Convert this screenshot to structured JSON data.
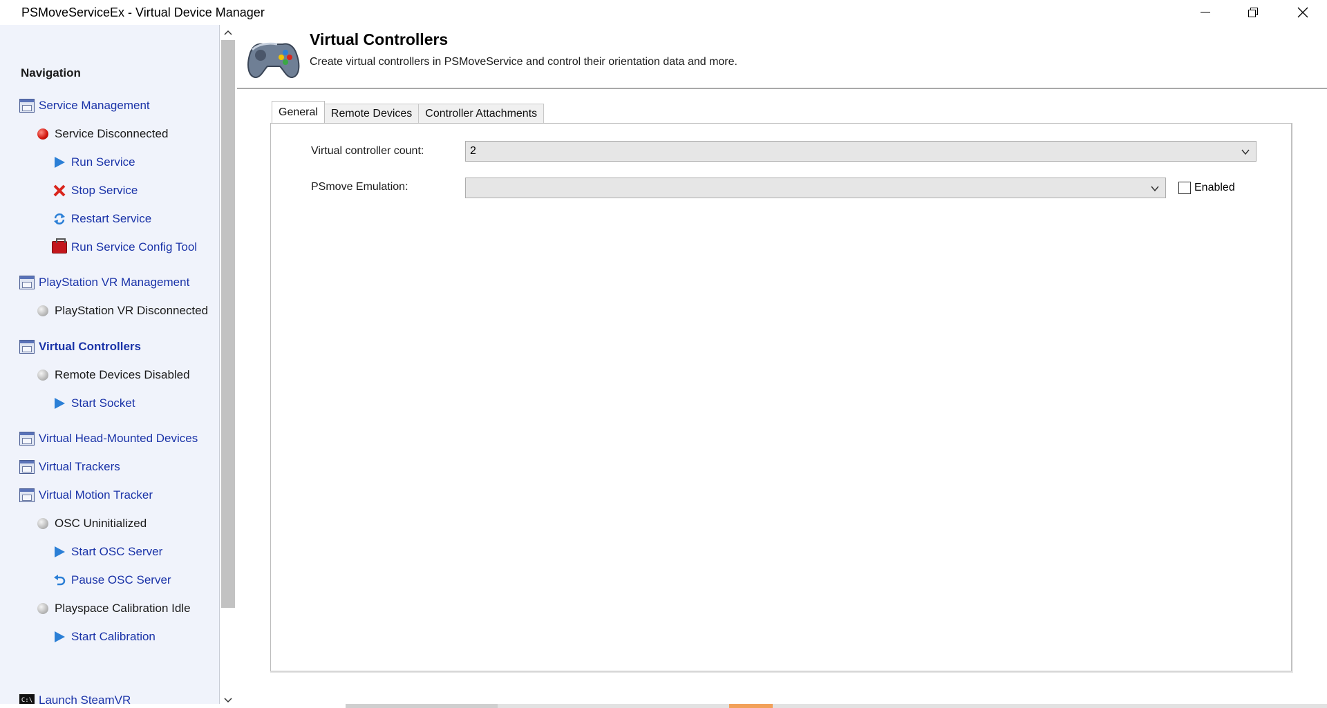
{
  "window": {
    "title": "PSMoveServiceEx - Virtual Device Manager",
    "minimize_icon": "minimize-icon",
    "maximize_icon": "restore-icon",
    "close_icon": "close-icon"
  },
  "sidebar": {
    "heading": "Navigation",
    "items": [
      {
        "label": "Service Management",
        "icon": "pc-icon"
      },
      {
        "label": "Service Disconnected",
        "icon": "red-status-dot"
      },
      {
        "label": "Run Service",
        "icon": "play-icon"
      },
      {
        "label": "Stop Service",
        "icon": "stop-x-icon"
      },
      {
        "label": "Restart Service",
        "icon": "refresh-icon"
      },
      {
        "label": "Run Service Config Tool",
        "icon": "toolbox-icon"
      },
      {
        "label": "PlayStation VR Management",
        "icon": "pc-icon"
      },
      {
        "label": "PlayStation VR Disconnected",
        "icon": "grey-status-dot"
      },
      {
        "label": "Virtual Controllers",
        "icon": "pc-icon"
      },
      {
        "label": "Remote Devices Disabled",
        "icon": "grey-status-dot"
      },
      {
        "label": "Start Socket",
        "icon": "play-icon"
      },
      {
        "label": "Virtual Head-Mounted Devices",
        "icon": "pc-icon"
      },
      {
        "label": "Virtual Trackers",
        "icon": "pc-icon"
      },
      {
        "label": "Virtual Motion Tracker",
        "icon": "pc-icon"
      },
      {
        "label": "OSC Uninitialized",
        "icon": "grey-status-dot"
      },
      {
        "label": "Start OSC Server",
        "icon": "play-icon"
      },
      {
        "label": "Pause OSC Server",
        "icon": "undo-icon"
      },
      {
        "label": "Playspace Calibration Idle",
        "icon": "grey-status-dot"
      },
      {
        "label": "Start Calibration",
        "icon": "play-icon"
      },
      {
        "label": "Launch SteamVR",
        "icon": "console-icon"
      }
    ]
  },
  "header": {
    "title": "Virtual Controllers",
    "subtitle": "Create virtual controllers in PSMoveService and control their orientation data and more.",
    "icon": "gamepad-icon"
  },
  "tabs": [
    {
      "label": "General",
      "active": true
    },
    {
      "label": "Remote Devices",
      "active": false
    },
    {
      "label": "Controller Attachments",
      "active": false
    }
  ],
  "general": {
    "controller_count_label": "Virtual controller count:",
    "controller_count_value": "2",
    "psmove_emulation_label": "PSmove Emulation:",
    "psmove_emulation_value": "",
    "enabled_label": "Enabled",
    "enabled_checked": false
  },
  "colors": {
    "link": "#1a33a8",
    "sidebar_bg": "#f0f3fb",
    "accent_play": "#2b7fd6",
    "stop_red": "#d9251d"
  }
}
